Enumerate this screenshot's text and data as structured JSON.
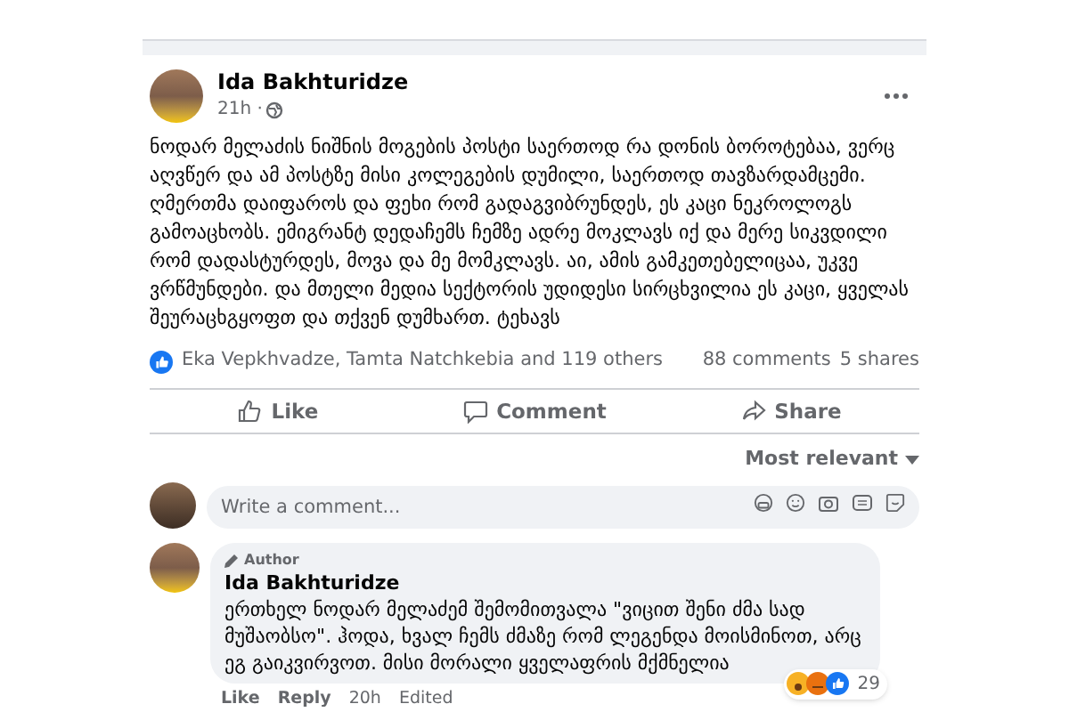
{
  "post": {
    "author": "Ida Bakhturidze",
    "time": "21h ·",
    "text": "ნოდარ მელაძის ნიშნის მოგების პოსტი საერთოდ რა დონის ბოროტებაა, ვერც აღვწერ და ამ პოსტზე მისი კოლეგების დუმილი, საერთოდ თავზარდამცემი. ღმერთმა დაიფაროს და ფეხი რომ გადაგვიბრუნდეს, ეს კაცი ნეკროლოგს გამოაცხობს. ემიგრანტ დედაჩემს ჩემზე ადრე მოკლავს იქ და მერე სიკვდილი რომ დადასტურდეს, მოვა და მე მომკლავს. აი, ამის გამკეთებელიცაა, უკვე ვრწმუნდები. და მთელი მედია სექტორის უდიდესი სირცხვილია ეს კაცი, ყველას შეურაცხგყოფთ და თქვენ დუმხართ. ტეხავს",
    "reactions": "Eka Vepkhvadze, Tamta Natchkebia and 119 others",
    "comments_count": "88 comments",
    "shares_count": "5 shares"
  },
  "actions": [
    {
      "kind": "like",
      "label": "Like"
    },
    {
      "kind": "comment",
      "label": "Comment"
    },
    {
      "kind": "share",
      "label": "Share"
    }
  ],
  "sort": "Most relevant",
  "comment_input": {
    "placeholder": "Write a comment..."
  },
  "comments": [
    {
      "badge": "Author",
      "author": "Ida Bakhturidze",
      "text": "ერთხელ ნოდარ მელაძემ შემომითვალა \"ვიცით შენი ძმა სად მუშაობსო\". ჰოდა, ხვალ ჩემს ძმაზე რომ ლეგენდა მოისმინოთ, არც ეგ გაიკვირვოთ. მისი მორალი ყველაფრის მქმნელია",
      "reaction_count": "29",
      "links": [
        "Like",
        "Reply"
      ],
      "time": "20h",
      "edited": "Edited"
    }
  ]
}
